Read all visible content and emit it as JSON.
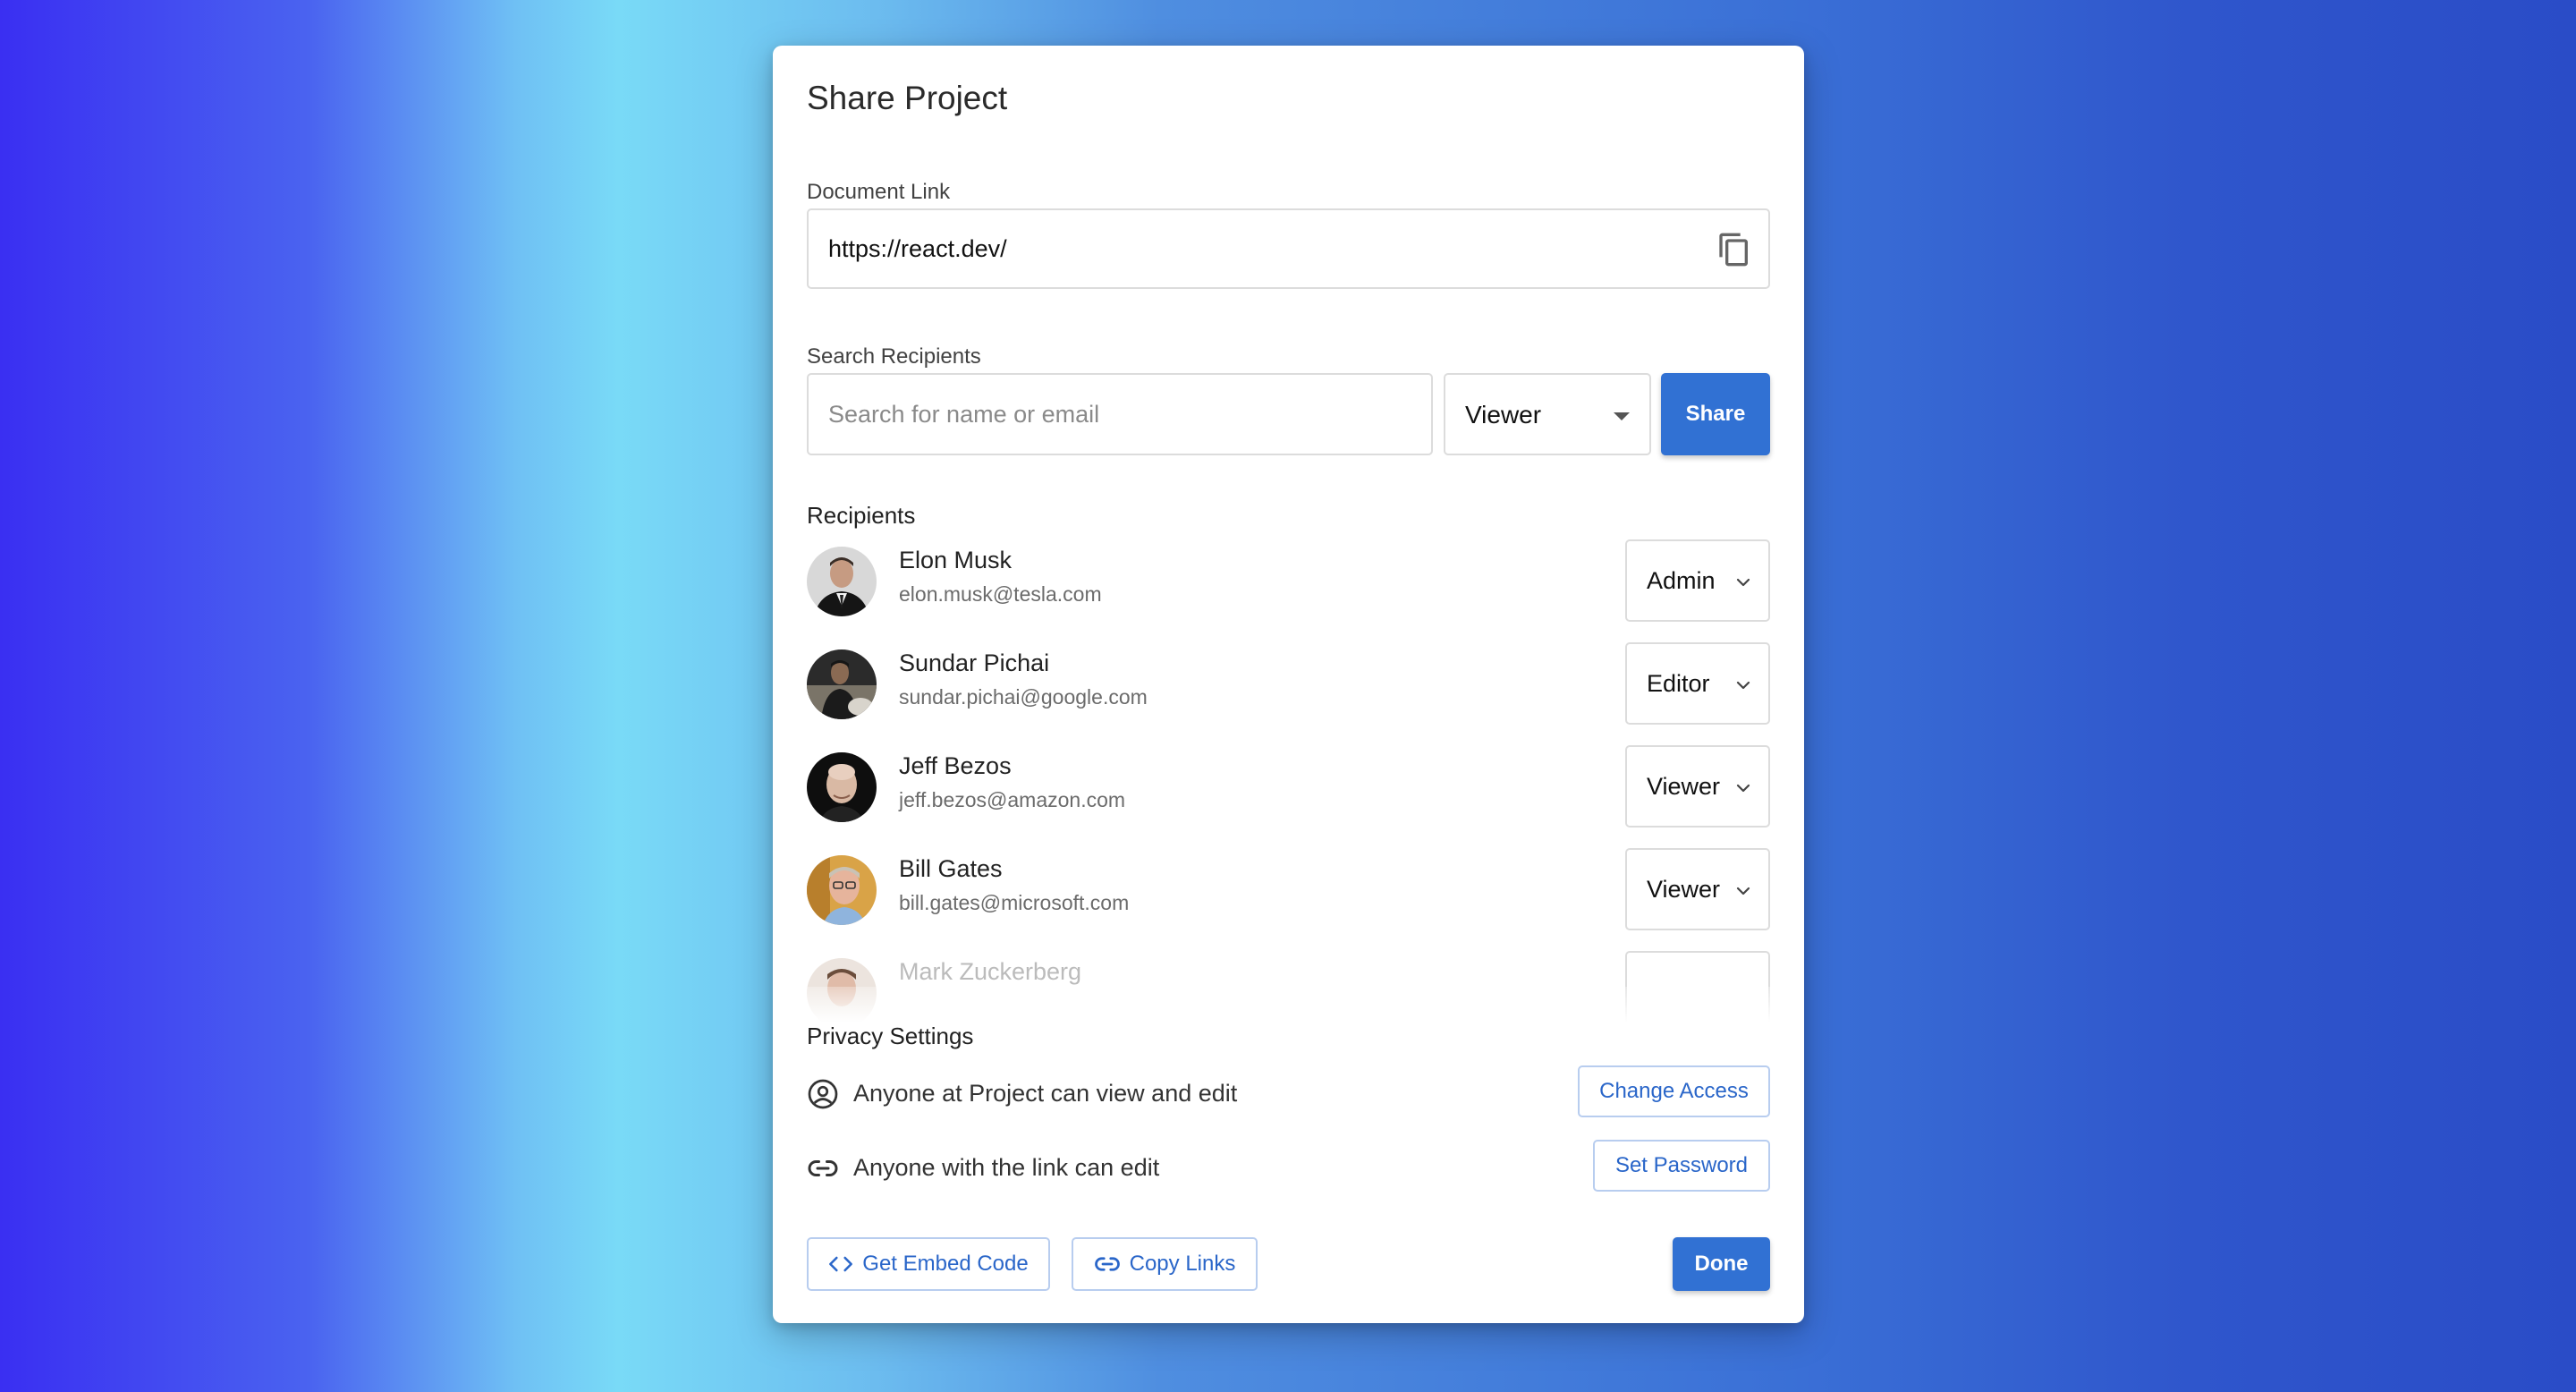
{
  "dialog": {
    "title": "Share Project",
    "document_link": {
      "label": "Document Link",
      "value": "https://react.dev/",
      "icon": "copy-icon"
    },
    "search": {
      "label": "Search Recipients",
      "placeholder": "Search for name or email",
      "role_selected": "Viewer",
      "share_label": "Share"
    },
    "recipients": {
      "heading": "Recipients",
      "items": [
        {
          "name": "Elon Musk",
          "email": "elon.musk@tesla.com",
          "role": "Admin",
          "avatar_color": "#c9c9c9"
        },
        {
          "name": "Sundar Pichai",
          "email": "sundar.pichai@google.com",
          "role": "Editor",
          "avatar_color": "#2b2b2b"
        },
        {
          "name": "Jeff Bezos",
          "email": "jeff.bezos@amazon.com",
          "role": "Viewer",
          "avatar_color": "#111111"
        },
        {
          "name": "Bill Gates",
          "email": "bill.gates@microsoft.com",
          "role": "Viewer",
          "avatar_color": "#d9a347"
        },
        {
          "name": "Mark Zuckerberg",
          "email": "",
          "role": "",
          "avatar_color": "#e6d6cf"
        }
      ]
    },
    "privacy": {
      "heading": "Privacy Settings",
      "rows": [
        {
          "text": "Anyone at Project can view and edit",
          "icon": "user-circle-icon",
          "button": "Change Access"
        },
        {
          "text": "Anyone with the link can edit",
          "icon": "link-icon",
          "button": "Set Password"
        }
      ]
    },
    "footer": {
      "embed_label": "Get Embed Code",
      "copy_links_label": "Copy Links",
      "done_label": "Done"
    }
  },
  "colors": {
    "primary": "#3171d3",
    "outline_text": "#2a66c9",
    "border": "#dcdcdc"
  }
}
